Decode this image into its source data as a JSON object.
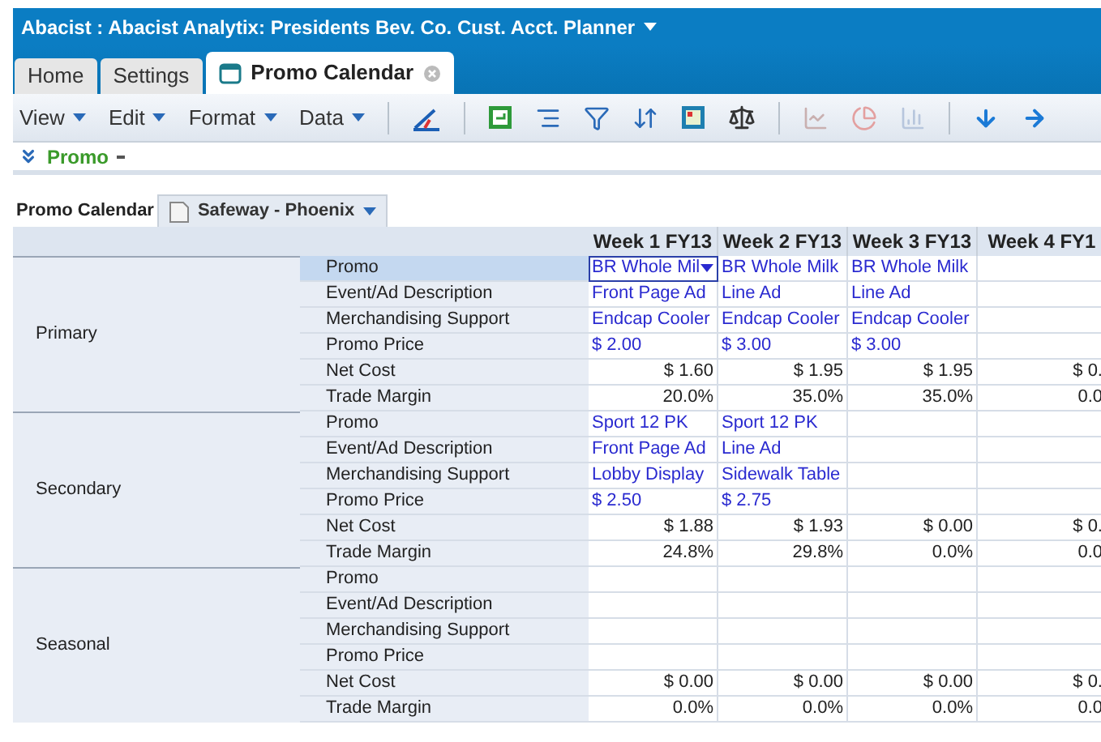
{
  "window": {
    "title": "Abacist : Abacist Analytix: Presidents Bev. Co. Cust. Acct. Planner"
  },
  "tabs": [
    {
      "label": "Home",
      "selected": false
    },
    {
      "label": "Settings",
      "selected": false
    },
    {
      "label": "Promo Calendar",
      "selected": true
    }
  ],
  "menus": [
    "View",
    "Edit",
    "Format",
    "Data"
  ],
  "filter": {
    "label": "Promo"
  },
  "sheet_tabs": [
    {
      "label": "Promo Calendar",
      "selected": true
    },
    {
      "label": "Safeway - Phoenix",
      "selected": false
    }
  ],
  "table": {
    "columns": [
      "Week 1 FY13",
      "Week 2 FY13",
      "Week 3 FY13",
      "Week 4 FY1"
    ],
    "groups": [
      {
        "name": "Primary",
        "rows": [
          {
            "label": "Promo",
            "kind": "input",
            "selected": true,
            "cells": [
              {
                "text": "BR Whole Mil",
                "selected": true
              },
              {
                "text": "BR Whole Milk",
                "selected": false
              },
              {
                "text": "BR Whole Milk",
                "selected": false
              },
              null
            ]
          },
          {
            "label": "Event/Ad Description",
            "kind": "input",
            "selected": false,
            "cells": [
              {
                "text": "Front Page Ad",
                "selected": false
              },
              {
                "text": "Line Ad",
                "selected": false
              },
              {
                "text": "Line Ad",
                "selected": false
              },
              null
            ]
          },
          {
            "label": "Merchandising Support",
            "kind": "input",
            "selected": false,
            "cells": [
              {
                "text": "Endcap Cooler",
                "selected": false
              },
              {
                "text": "Endcap Cooler",
                "selected": false
              },
              {
                "text": "Endcap Cooler",
                "selected": false
              },
              null
            ]
          },
          {
            "label": "Promo Price",
            "kind": "input",
            "selected": false,
            "cells": [
              {
                "text": "$ 2.00",
                "selected": false
              },
              {
                "text": "$ 3.00",
                "selected": false
              },
              {
                "text": "$ 3.00",
                "selected": false
              },
              null
            ]
          },
          {
            "label": "Net Cost",
            "kind": "calc",
            "selected": false,
            "cells": [
              {
                "text": "$ 1.60",
                "selected": false
              },
              {
                "text": "$ 1.95",
                "selected": false
              },
              {
                "text": "$ 1.95",
                "selected": false
              },
              {
                "text": "$ 0.",
                "selected": false
              }
            ]
          },
          {
            "label": "Trade Margin",
            "kind": "calc",
            "selected": false,
            "cells": [
              {
                "text": "20.0%",
                "selected": false
              },
              {
                "text": "35.0%",
                "selected": false
              },
              {
                "text": "35.0%",
                "selected": false
              },
              {
                "text": "0.0",
                "selected": false
              }
            ]
          }
        ]
      },
      {
        "name": "Secondary",
        "rows": [
          {
            "label": "Promo",
            "kind": "input",
            "selected": false,
            "cells": [
              {
                "text": "Sport 12 PK",
                "selected": false
              },
              {
                "text": "Sport 12 PK",
                "selected": false
              },
              null,
              null
            ]
          },
          {
            "label": "Event/Ad Description",
            "kind": "input",
            "selected": false,
            "cells": [
              {
                "text": "Front Page Ad",
                "selected": false
              },
              {
                "text": "Line Ad",
                "selected": false
              },
              null,
              null
            ]
          },
          {
            "label": "Merchandising Support",
            "kind": "input",
            "selected": false,
            "cells": [
              {
                "text": "Lobby Display",
                "selected": false
              },
              {
                "text": "Sidewalk Table",
                "selected": false
              },
              null,
              null
            ]
          },
          {
            "label": "Promo Price",
            "kind": "input",
            "selected": false,
            "cells": [
              {
                "text": "$ 2.50",
                "selected": false
              },
              {
                "text": "$ 2.75",
                "selected": false
              },
              null,
              null
            ]
          },
          {
            "label": "Net Cost",
            "kind": "calc",
            "selected": false,
            "cells": [
              {
                "text": "$ 1.88",
                "selected": false
              },
              {
                "text": "$ 1.93",
                "selected": false
              },
              {
                "text": "$ 0.00",
                "selected": false
              },
              {
                "text": "$ 0.",
                "selected": false
              }
            ]
          },
          {
            "label": "Trade Margin",
            "kind": "calc",
            "selected": false,
            "cells": [
              {
                "text": "24.8%",
                "selected": false
              },
              {
                "text": "29.8%",
                "selected": false
              },
              {
                "text": "0.0%",
                "selected": false
              },
              {
                "text": "0.0",
                "selected": false
              }
            ]
          }
        ]
      },
      {
        "name": "Seasonal",
        "rows": [
          {
            "label": "Promo",
            "kind": "input",
            "selected": false,
            "cells": [
              null,
              null,
              null,
              null
            ]
          },
          {
            "label": "Event/Ad Description",
            "kind": "input",
            "selected": false,
            "cells": [
              null,
              null,
              null,
              null
            ]
          },
          {
            "label": "Merchandising Support",
            "kind": "input",
            "selected": false,
            "cells": [
              null,
              null,
              null,
              null
            ]
          },
          {
            "label": "Promo Price",
            "kind": "input",
            "selected": false,
            "cells": [
              null,
              null,
              null,
              null
            ]
          },
          {
            "label": "Net Cost",
            "kind": "calc",
            "selected": false,
            "cells": [
              {
                "text": "$ 0.00",
                "selected": false
              },
              {
                "text": "$ 0.00",
                "selected": false
              },
              {
                "text": "$ 0.00",
                "selected": false
              },
              {
                "text": "$ 0.",
                "selected": false
              }
            ]
          },
          {
            "label": "Trade Margin",
            "kind": "calc",
            "selected": false,
            "cells": [
              {
                "text": "0.0%",
                "selected": false
              },
              {
                "text": "0.0%",
                "selected": false
              },
              {
                "text": "0.0%",
                "selected": false
              },
              {
                "text": "0.0",
                "selected": false
              }
            ]
          }
        ]
      }
    ]
  }
}
